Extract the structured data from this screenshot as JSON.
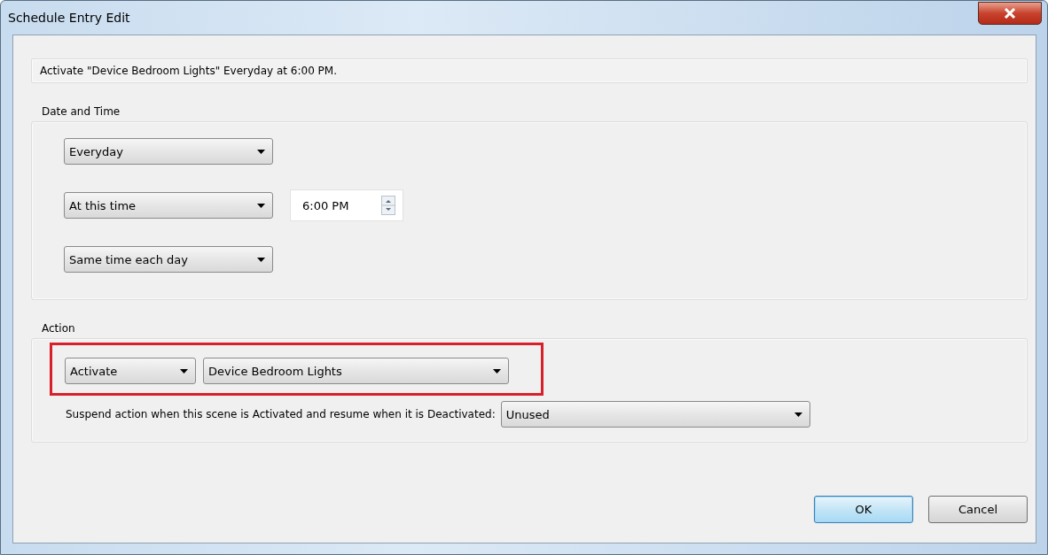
{
  "window": {
    "title": "Schedule Entry Edit"
  },
  "summary": "Activate \"Device Bedroom Lights\" Everyday at 6:00 PM.",
  "date_and_time": {
    "label": "Date and Time",
    "rows": [
      {
        "dropdown": "Everyday"
      },
      {
        "dropdown": "At this time",
        "time_field": "6:00 PM"
      },
      {
        "dropdown": "Same time each day"
      }
    ]
  },
  "action": {
    "label": "Action",
    "highlighted": true,
    "action_dropdown": "Activate",
    "target_dropdown": "Device Bedroom Lights",
    "suspend_label": "Suspend action when this scene is Activated and resume when it is Deactivated:",
    "suspend_dropdown": "Unused"
  },
  "buttons": [
    {
      "label": "OK",
      "default": true
    },
    {
      "label": "Cancel",
      "default": false
    }
  ]
}
